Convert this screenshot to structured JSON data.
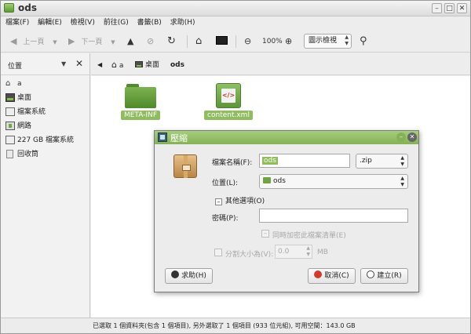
{
  "window": {
    "title": "ods"
  },
  "menu": [
    "檔案(F)",
    "編輯(E)",
    "檢視(V)",
    "前往(G)",
    "書籤(B)",
    "求助(H)"
  ],
  "toolbar": {
    "back_label": "上一頁",
    "forward_label": "下一頁",
    "zoom_level": "100%",
    "view_mode": "圖示檢視"
  },
  "sidepane": {
    "title": "位置",
    "items": [
      {
        "label": "a",
        "icon": "home-icon"
      },
      {
        "label": "桌面",
        "icon": "desktop-icon"
      },
      {
        "label": "檔案系統",
        "icon": "filesystem-icon"
      },
      {
        "label": "網路",
        "icon": "network-icon"
      },
      {
        "label": "227 GB 檔案系統",
        "icon": "drive-icon"
      },
      {
        "label": "回收筒",
        "icon": "trash-icon"
      }
    ]
  },
  "pathbar": {
    "home": "a",
    "desktop": "桌面",
    "current": "ods"
  },
  "files": [
    {
      "name": "META-INF",
      "type": "folder"
    },
    {
      "name": "content.xml",
      "type": "xml"
    }
  ],
  "statusbar": "已選取 1 個資料夾(包含 1 個項目), 另外選取了 1 個項目 (933 位元組), 可用空間：143.0 GB",
  "dialog": {
    "title": "壓縮",
    "filename_label": "檔案名稱(F):",
    "filename_value": "ods",
    "extension": ".zip",
    "location_label": "位置(L):",
    "location_value": "ods",
    "more_options": "其他選項(O)",
    "password_label": "密碼(P):",
    "password_value": "",
    "encrypt_list_label": "同時加密此檔案清單(E)",
    "split_label": "分割大小為(V):",
    "split_value": "0.0",
    "split_unit": "MB",
    "help_button": "求助(H)",
    "cancel_button": "取消(C)",
    "create_button": "建立(R)"
  },
  "colors": {
    "accent": "#8fbc5e",
    "dialog_title": "#94bf68"
  }
}
